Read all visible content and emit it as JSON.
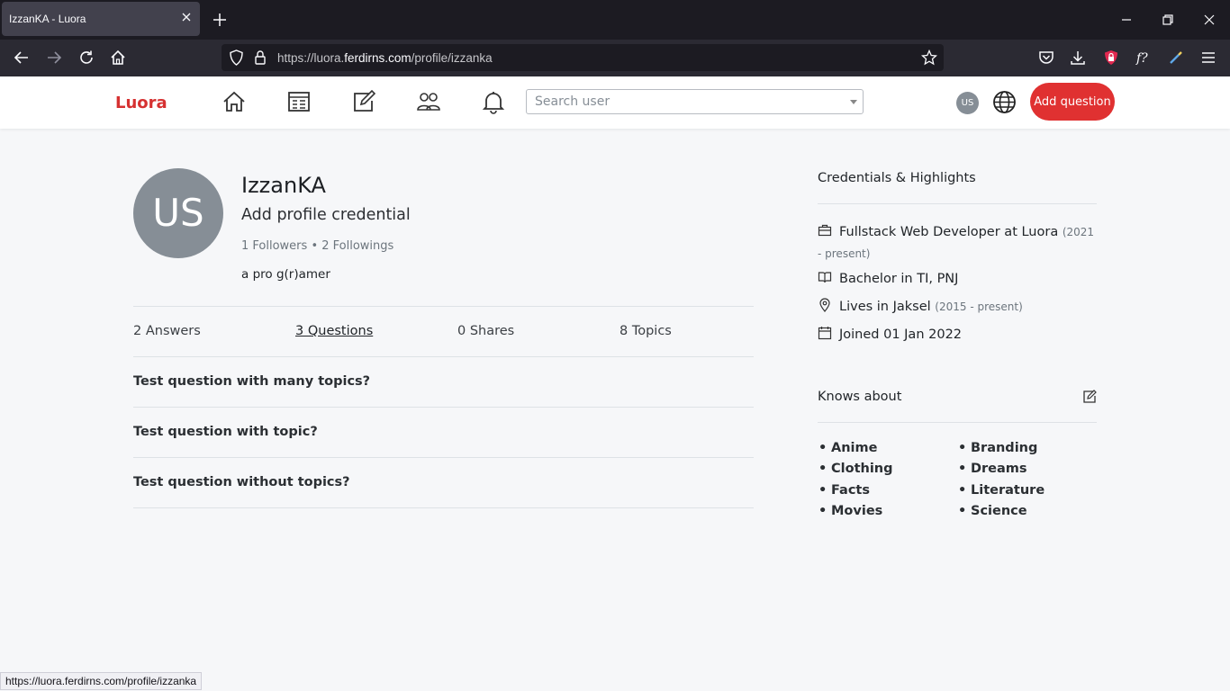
{
  "browser": {
    "tab_title": "IzzanKA - Luora",
    "url_prefix": "https://luora.",
    "url_domain": "ferdirns.com",
    "url_path": "/profile/izzanka",
    "status_url": "https://luora.ferdirns.com/profile/izzanka"
  },
  "header": {
    "brand": "Luora",
    "search_placeholder": "Search user",
    "avatar_initials": "US",
    "add_question_label": "Add question"
  },
  "profile": {
    "avatar_initials": "US",
    "username": "IzzanKA",
    "credential": "Add profile credential",
    "followers": "1 Followers",
    "separator": "•",
    "followings": "2 Followings",
    "bio": "a pro g(r)amer"
  },
  "stats": [
    {
      "label": "2 Answers"
    },
    {
      "label": "3 Questions"
    },
    {
      "label": "0 Shares"
    },
    {
      "label": "8 Topics"
    }
  ],
  "questions": [
    "Test question with many topics?",
    "Test question with topic?",
    "Test question without topics?"
  ],
  "credentials": {
    "title": "Credentials & Highlights",
    "job": "Fullstack Web Developer at Luora",
    "job_period": "(2021 - present)",
    "education": "Bachelor in TI, PNJ",
    "location": "Lives in Jaksel",
    "location_period": "(2015 - present)",
    "joined": "Joined 01 Jan 2022"
  },
  "knows_about": {
    "title": "Knows about",
    "topics": [
      "Anime",
      "Branding",
      "Clothing",
      "Dreams",
      "Facts",
      "Literature",
      "Movies",
      "Science"
    ]
  },
  "colors": {
    "brand": "#d63131",
    "button": "#e03131",
    "avatar": "#868e96"
  }
}
